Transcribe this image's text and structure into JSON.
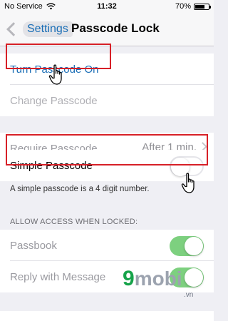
{
  "status_bar": {
    "carrier": "No Service",
    "time": "11:32",
    "battery": "70%",
    "battery_level": 0.7
  },
  "nav": {
    "back_label": "Settings",
    "title": "Passcode Lock"
  },
  "cells": {
    "turn_on": "Turn Passcode On",
    "change": "Change Passcode",
    "require_label": "Require Passcode",
    "require_value": "After 1 min.",
    "simple_label": "Simple Passcode",
    "passbook_label": "Passbook",
    "reply_label": "Reply with Message"
  },
  "footnote": "A simple passcode is a 4 digit number.",
  "section_header": "ALLOW ACCESS WHEN LOCKED:",
  "toggles": {
    "simple_passcode": false,
    "passbook": true,
    "reply_with_message": true
  },
  "colors": {
    "accent": "#1a6eb6",
    "toggle_on": "#7dd07f",
    "highlight": "#d72027",
    "background": "#efeff4"
  },
  "watermark": {
    "main_digit": "9",
    "main_text": "mobi",
    "domain": ".vn"
  }
}
